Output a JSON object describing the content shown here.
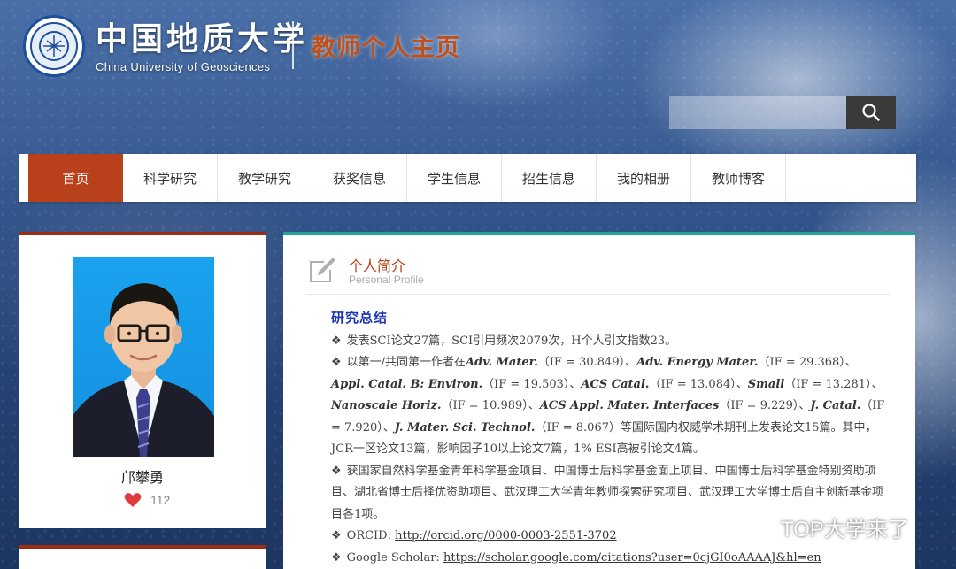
{
  "header": {
    "university_cn": "中国地质大学",
    "university_en": "China University of Geosciences",
    "site_title": "教师个人主页",
    "search_placeholder": ""
  },
  "nav": {
    "items": [
      {
        "label": "首页",
        "active": true
      },
      {
        "label": "科学研究"
      },
      {
        "label": "教学研究"
      },
      {
        "label": "获奖信息"
      },
      {
        "label": "学生信息"
      },
      {
        "label": "招生信息"
      },
      {
        "label": "我的相册"
      },
      {
        "label": "教师博客"
      }
    ]
  },
  "profile": {
    "name": "邝攀勇",
    "likes": "112"
  },
  "section": {
    "title": "个人简介",
    "subtitle": "Personal Profile"
  },
  "research": {
    "heading": "研究总结",
    "p1": "发表SCI论文27篇，SCI引用频次2079次，H个人引文指数23。",
    "p2": {
      "intro": "以第一/共同第一作者在",
      "j1": "Adv. Mater.",
      "if1": "（IF = 30.849）、",
      "j2": "Adv. Energy Mater.",
      "if2": "（IF = 29.368）、",
      "j3": "Appl. Catal. B: Environ.",
      "if3": "（IF = 19.503）、",
      "j4": "ACS Catal.",
      "if4": "（IF = 13.084）、",
      "j5": "Small",
      "if5": "（IF = 13.281）、",
      "j6": "Nanoscale Horiz.",
      "if6": "（IF = 10.989）、",
      "j7": "ACS Appl. Mater. Interfaces",
      "if7": "（IF = 9.229）、",
      "j8": "J. Catal.",
      "if8": "（IF = 7.920）、",
      "j9": "J. Mater. Sci. Technol.",
      "if9": "（IF = 8.067）等国际国内权威学术期刊上发表论文15篇。其中，JCR一区论文13篇，影响因子10以上论文7篇，1% ESI高被引论文4篇。"
    },
    "p3": "获国家自然科学基金青年科学基金项目、中国博士后科学基金面上项目、中国博士后科学基金特别资助项目、湖北省博士后择优资助项目、武汉理工大学青年教师探索研究项目、武汉理工大学博士后自主创新基金项目各1项。",
    "orcid_label": "ORCID: ",
    "orcid_url": "http://orcid.org/0000-0003-2551-3702",
    "scholar_label": "Google Scholar: ",
    "scholar_url": "https://scholar.google.com/citations?user=0cjGI0oAAAAJ&hl=en"
  },
  "watermark": "TOP大学来了",
  "bullet": "❖",
  "colors": {
    "accent": "#b8401a",
    "heading_blue": "#1b34b8",
    "panel_border": "#23a594"
  }
}
